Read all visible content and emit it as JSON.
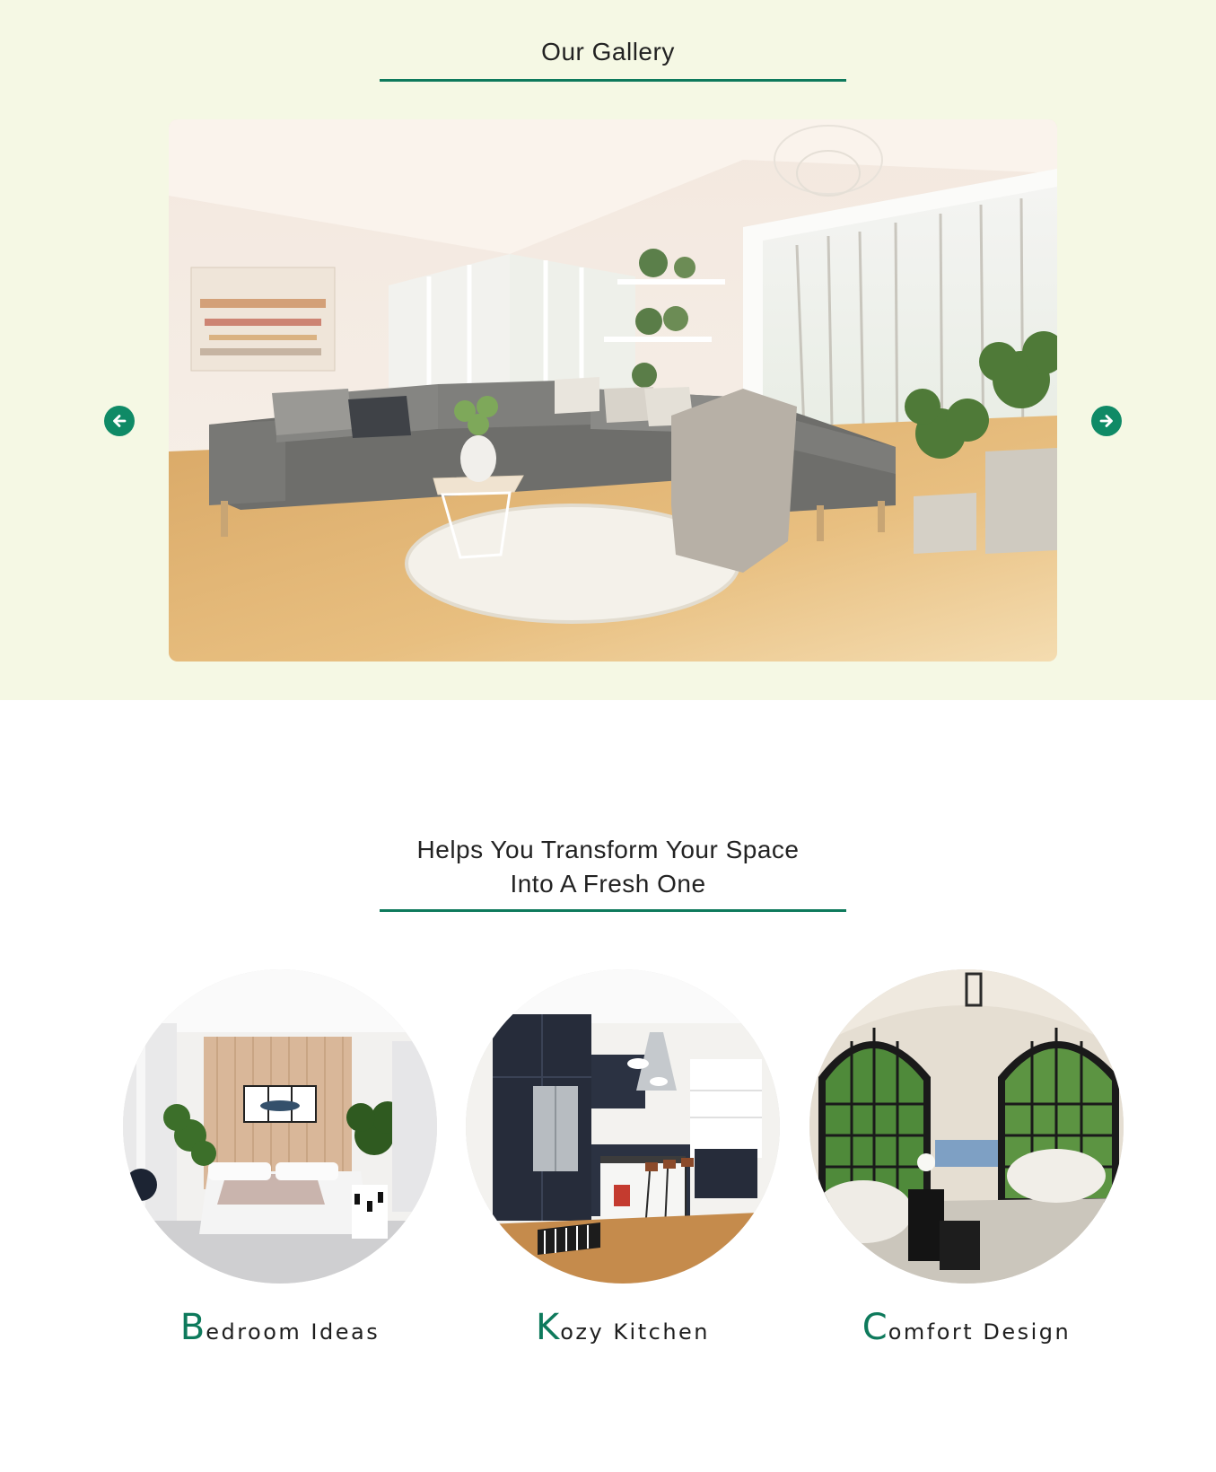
{
  "gallery": {
    "title": "Our Gallery",
    "prev_icon": "arrow-left-circle-icon",
    "next_icon": "arrow-right-circle-icon"
  },
  "transform": {
    "title_line1": "Helps You Transform Your Space",
    "title_line2": "Into A Fresh One"
  },
  "cards": [
    {
      "initial": "B",
      "rest": "edroom Ideas"
    },
    {
      "initial": "K",
      "rest": "ozy Kitchen"
    },
    {
      "initial": "C",
      "rest": "omfort Design"
    }
  ],
  "colors": {
    "accent": "#0e7a5c",
    "gallery_background": "#f5f8e4",
    "page_background": "#ffffff"
  }
}
